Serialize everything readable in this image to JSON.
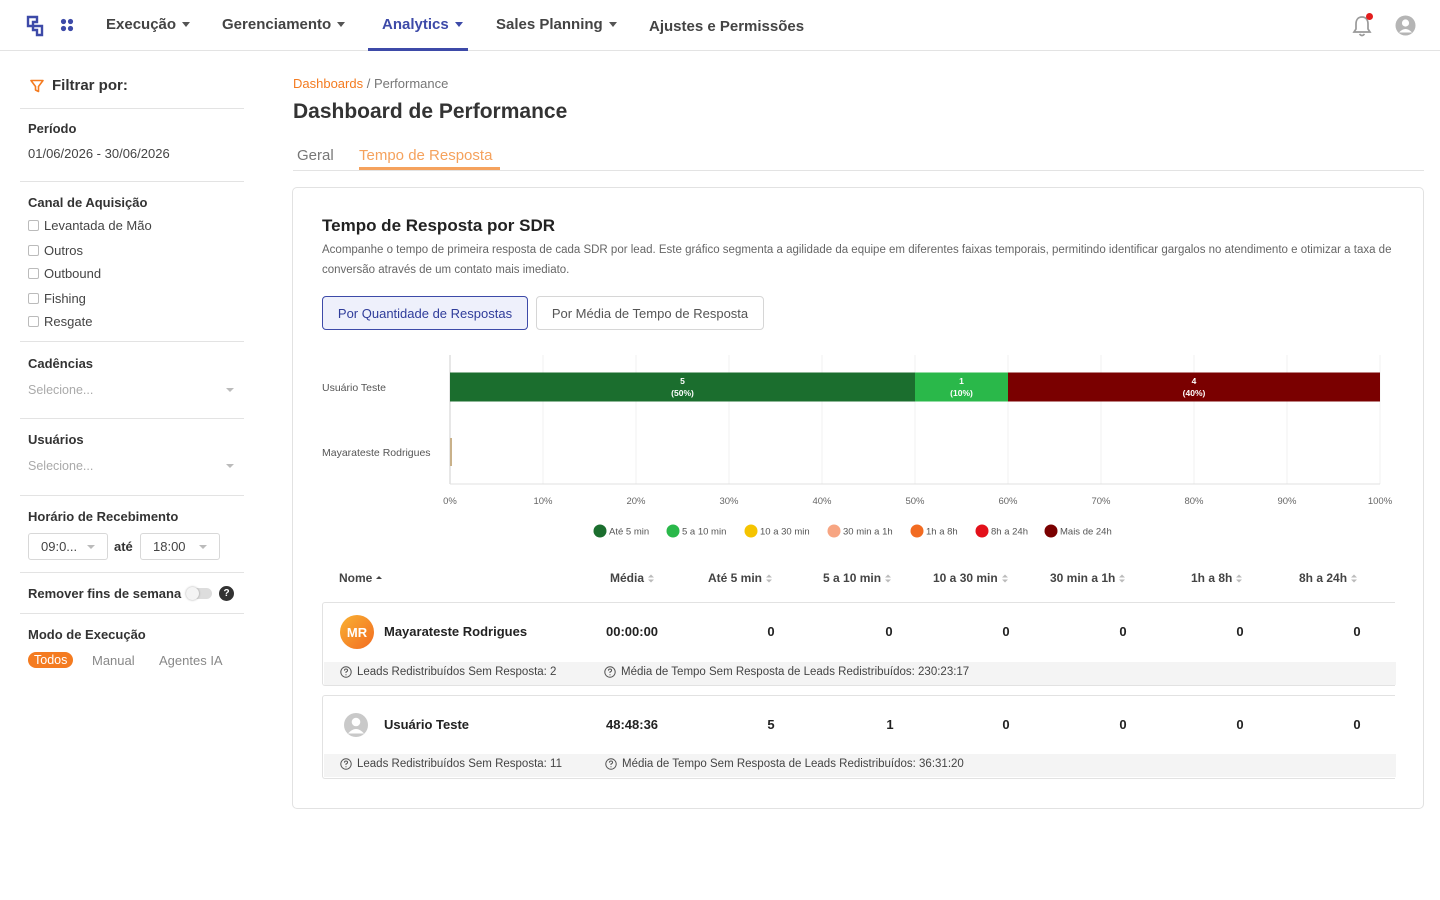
{
  "nav": {
    "items": [
      {
        "label": "Execução",
        "has_caret": true
      },
      {
        "label": "Gerenciamento",
        "has_caret": true
      },
      {
        "label": "Analytics",
        "has_caret": true,
        "active": true
      },
      {
        "label": "Sales Planning",
        "has_caret": true
      },
      {
        "label": "Ajustes e Permissões",
        "has_caret": false
      }
    ],
    "accent": "#3d4aa8",
    "notification_dot_color": "#e31d1d"
  },
  "sidebar": {
    "filter_title": "Filtrar por:",
    "period_label": "Período",
    "period_value": "01/06/2026 - 30/06/2026",
    "channel_label": "Canal de Aquisição",
    "channels": [
      "Levantada de Mão",
      "Outros",
      "Outbound",
      "Fishing",
      "Resgate"
    ],
    "cadences_label": "Cadências",
    "cadences_placeholder": "Selecione...",
    "users_label": "Usuários",
    "users_placeholder": "Selecione...",
    "time_label": "Horário de Recebimento",
    "time_from": "09:0...",
    "time_sep": "até",
    "time_to": "18:00",
    "weekend_label": "Remover fins de semana",
    "weekend_help": "?",
    "mode_label": "Modo de Execução",
    "modes": [
      "Todos",
      "Manual",
      "Agentes IA"
    ],
    "active_mode_color": "#f47b20"
  },
  "breadcrumb": {
    "link": "Dashboards",
    "sep": " / ",
    "current": "Performance"
  },
  "page_title": "Dashboard de Performance",
  "tabs": [
    {
      "label": "Geral",
      "active": false
    },
    {
      "label": "Tempo de Resposta",
      "active": true
    }
  ],
  "card": {
    "title": "Tempo de Resposta por SDR",
    "description": "Acompanhe o tempo de primeira resposta de cada SDR por lead. Este gráfico segmenta a agilidade da equipe em diferentes faixas temporais, permitindo identificar gargalos no atendimento e otimizar a taxa de conversão através de um contato mais imediato.",
    "toggle_buttons": [
      {
        "label": "Por Quantidade de Respostas",
        "active": true
      },
      {
        "label": "Por Média de Tempo de Resposta",
        "active": false
      }
    ]
  },
  "chart_data": {
    "type": "bar",
    "orientation": "horizontal",
    "stacked": true,
    "categories": [
      "Usuário Teste",
      "Mayarateste Rodrigues"
    ],
    "series": [
      {
        "name": "Até 5 min",
        "color": "#1b6e2e",
        "values": [
          5,
          0
        ],
        "labels": [
          "5",
          "(50%)"
        ]
      },
      {
        "name": "5 a 10 min",
        "color": "#2ab84a",
        "values": [
          1,
          0
        ],
        "labels": [
          "1",
          "(10%)"
        ]
      },
      {
        "name": "10 a 30 min",
        "color": "#f5c400",
        "values": [
          0,
          0
        ]
      },
      {
        "name": "30 min a 1h",
        "color": "#f7a582",
        "values": [
          0,
          0
        ]
      },
      {
        "name": "1h a 8h",
        "color": "#f26b21",
        "values": [
          0,
          0
        ]
      },
      {
        "name": "8h a 24h",
        "color": "#e3101a",
        "values": [
          0,
          0
        ]
      },
      {
        "name": "Mais de 24h",
        "color": "#7a0000",
        "values": [
          4,
          0
        ],
        "labels": [
          "4",
          "(40%)"
        ]
      }
    ],
    "x_ticks": [
      "0%",
      "10%",
      "20%",
      "30%",
      "40%",
      "50%",
      "60%",
      "70%",
      "80%",
      "90%",
      "100%"
    ],
    "xlim": [
      0,
      100
    ],
    "grid": true,
    "legend": "bottom"
  },
  "table": {
    "headers": [
      "Nome",
      "Média",
      "Até 5 min",
      "5 a 10 min",
      "10 a 30 min",
      "30 min a 1h",
      "1h a 8h",
      "8h a 24h"
    ],
    "rows": [
      {
        "initials": "MR",
        "name": "Mayarateste Rodrigues",
        "media": "00:00:00",
        "values": [
          "0",
          "0",
          "0",
          "0",
          "0",
          "0"
        ],
        "foot_left": "Leads Redistribuídos Sem Resposta: 2",
        "foot_right": "Média de Tempo Sem Resposta de Leads Redistribuídos: 230:23:17"
      },
      {
        "initials": "",
        "name": "Usuário Teste",
        "media": "48:48:36",
        "values": [
          "5",
          "1",
          "0",
          "0",
          "0",
          "0"
        ],
        "foot_left": "Leads Redistribuídos Sem Resposta: 11",
        "foot_right": "Média de Tempo Sem Resposta de Leads Redistribuídos: 36:31:20"
      }
    ]
  }
}
